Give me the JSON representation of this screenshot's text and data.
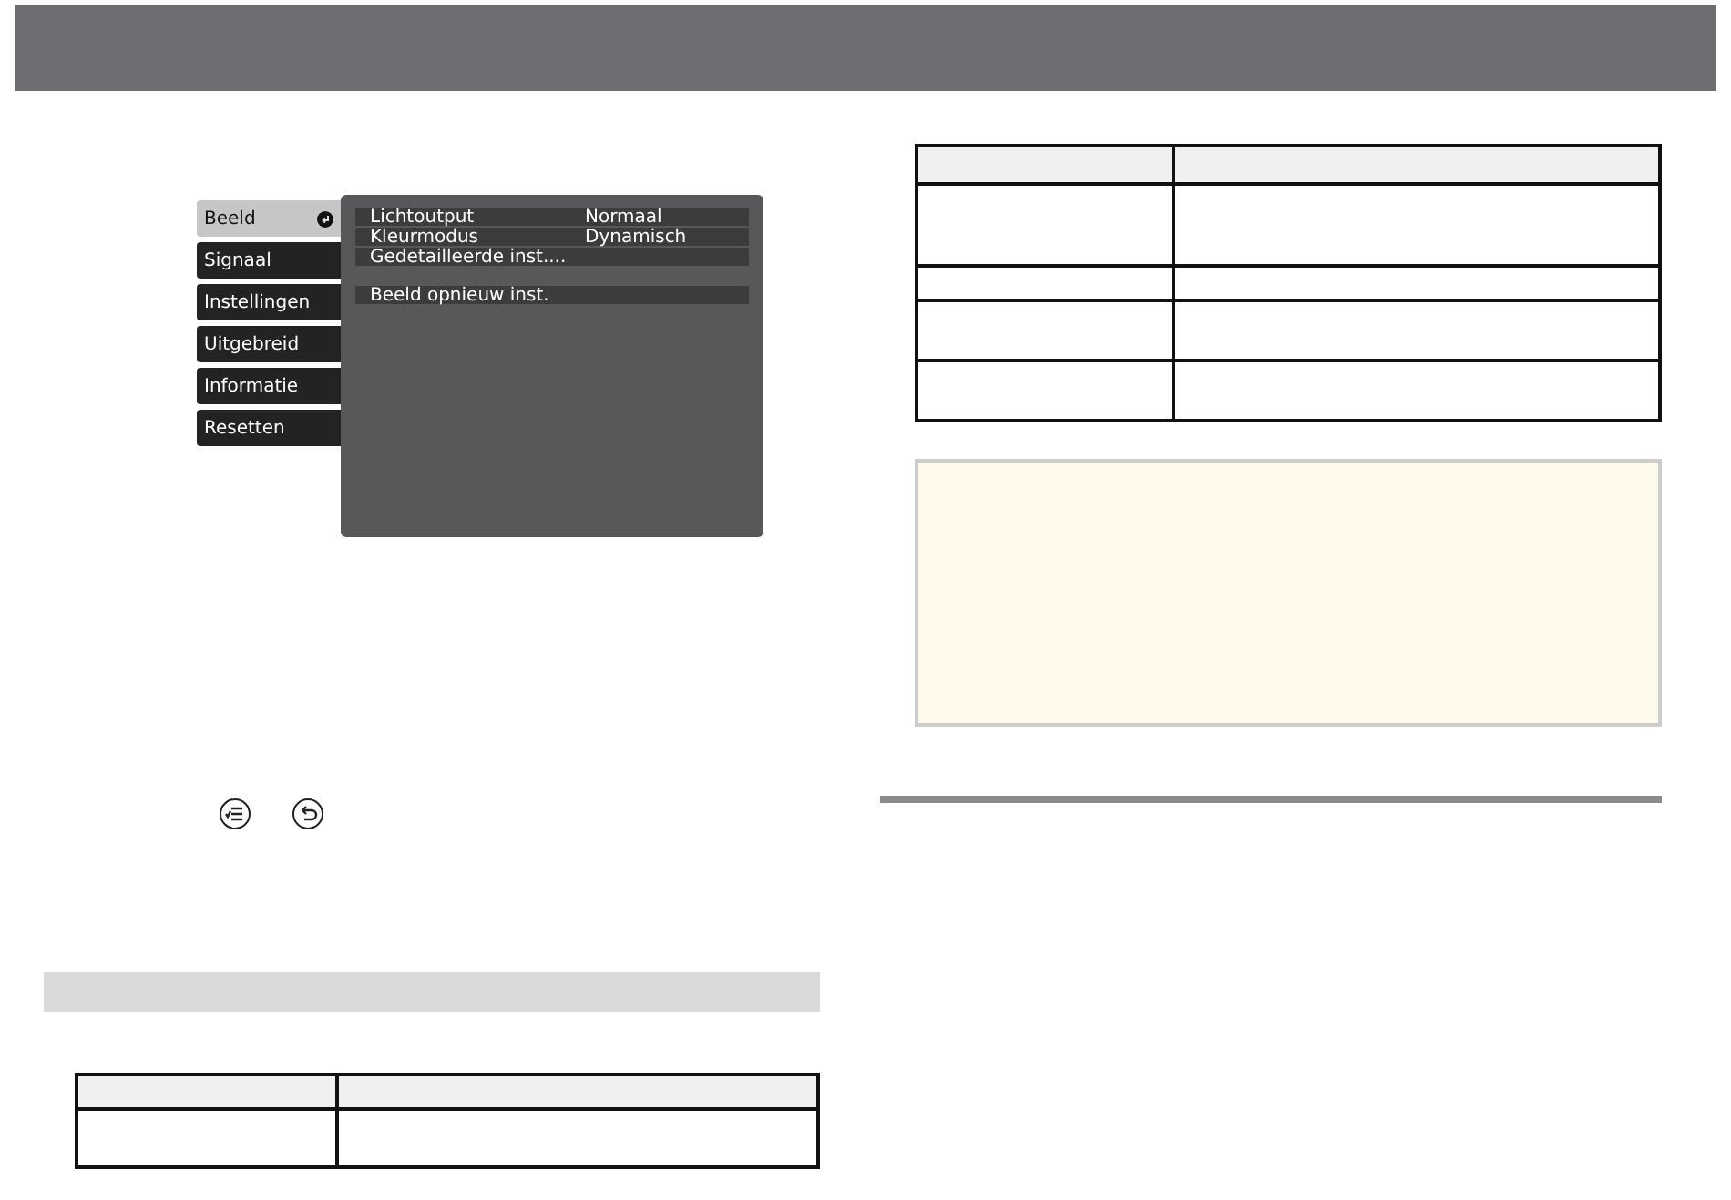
{
  "menu": {
    "tabs": [
      {
        "label": "Beeld",
        "selected": true
      },
      {
        "label": "Signaal",
        "selected": false
      },
      {
        "label": "Instellingen",
        "selected": false
      },
      {
        "label": "Uitgebreid",
        "selected": false
      },
      {
        "label": "Informatie",
        "selected": false
      },
      {
        "label": "Resetten",
        "selected": false
      }
    ],
    "groups": [
      [
        {
          "label": "Lichtoutput",
          "value": "Normaal"
        },
        {
          "label": "Kleurmodus",
          "value": "Dynamisch"
        },
        {
          "label": "Gedetailleerde inst...."
        }
      ],
      [
        {
          "label": "Beeld opnieuw inst."
        }
      ]
    ]
  }
}
